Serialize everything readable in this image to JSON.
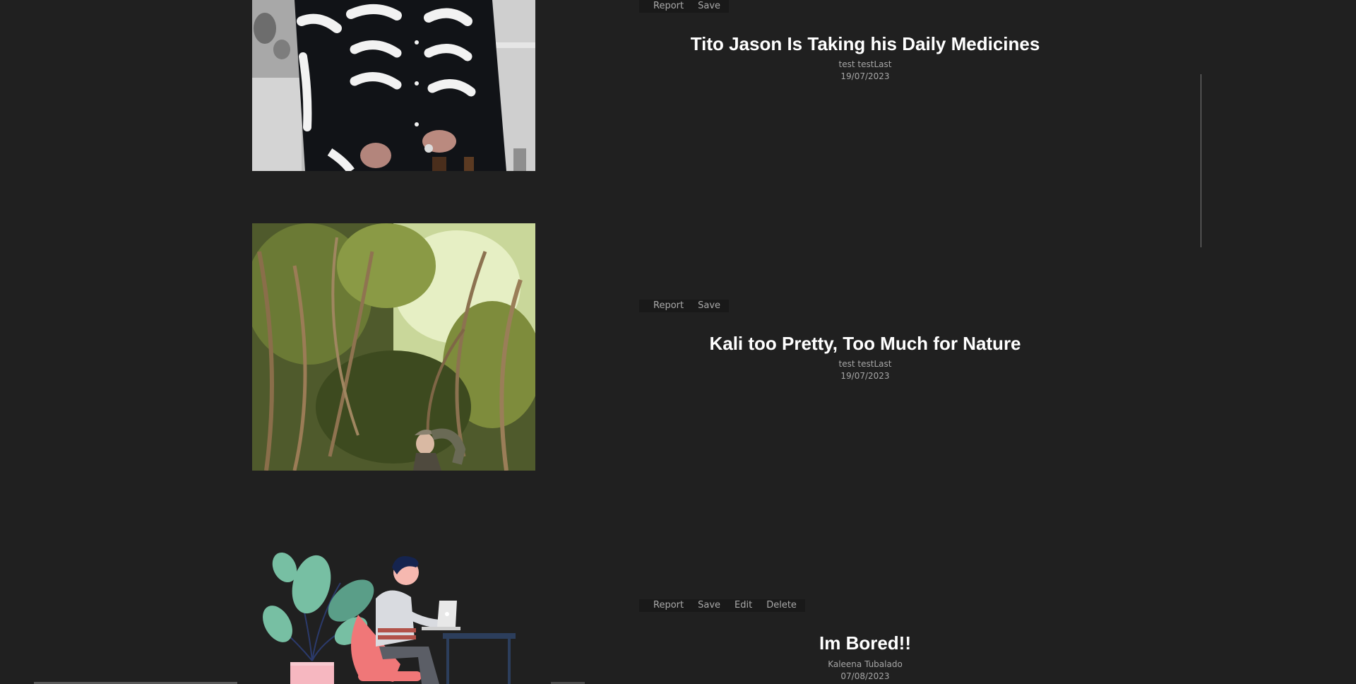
{
  "posts": [
    {
      "actions": [
        "Report",
        "Save"
      ],
      "title": "Tito Jason Is Taking his Daily Medicines",
      "author": "test testLast",
      "date": "19/07/2023"
    },
    {
      "actions": [
        "Report",
        "Save"
      ],
      "title": "Kali too Pretty, Too Much for Nature",
      "author": "test testLast",
      "date": "19/07/2023"
    },
    {
      "actions": [
        "Report",
        "Save",
        "Edit",
        "Delete"
      ],
      "title": "Im Bored!!",
      "author": "Kaleena Tubalado",
      "date": "07/08/2023"
    }
  ]
}
